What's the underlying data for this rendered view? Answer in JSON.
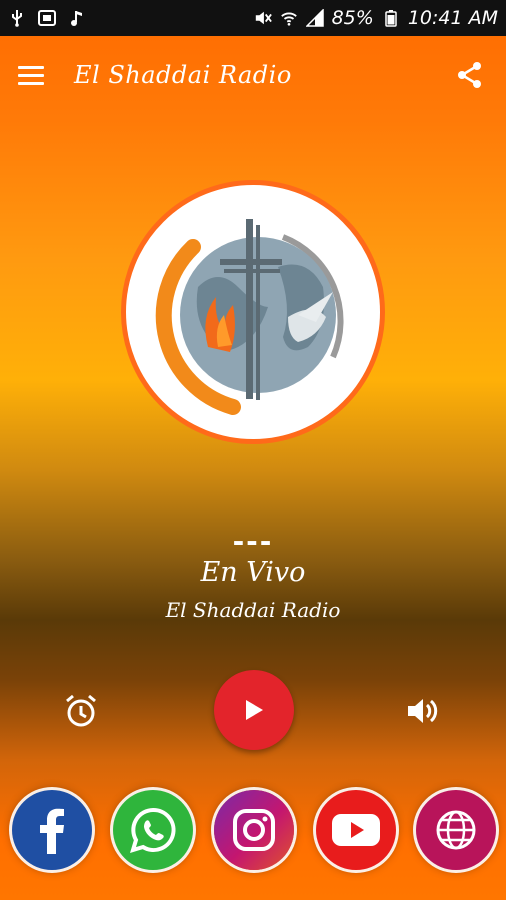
{
  "status_bar": {
    "battery": "85%",
    "time": "10:41 AM"
  },
  "toolbar": {
    "title": "El Shaddai Radio"
  },
  "player": {
    "dashes": "---",
    "track_title": "En Vivo",
    "station_name": "El Shaddai Radio"
  },
  "controls": {
    "alarm_icon": "alarm-clock-icon",
    "play_icon": "play-icon",
    "volume_icon": "volume-icon"
  },
  "social": [
    "facebook",
    "whatsapp",
    "instagram",
    "youtube",
    "website"
  ],
  "colors": {
    "accent": "#ff6a00",
    "play": "#e3242b",
    "facebook": "#1f4fa3",
    "whatsapp": "#2fb53c",
    "instagram": "#b0127a",
    "youtube": "#e81c1c",
    "website": "#b8145a"
  }
}
